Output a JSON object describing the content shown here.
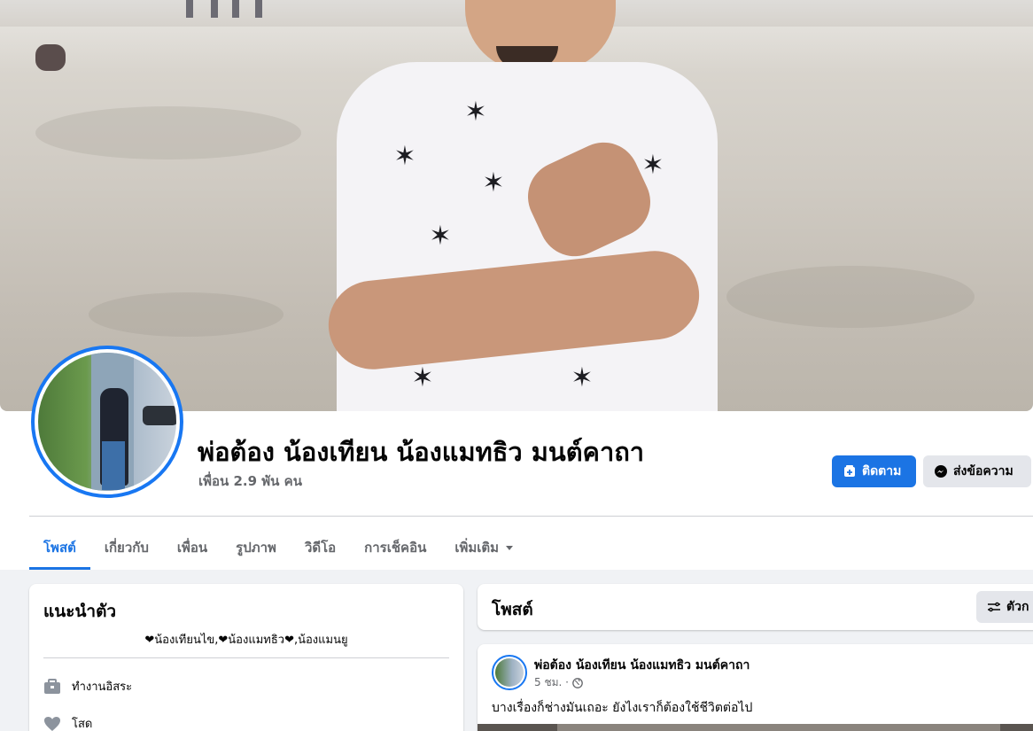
{
  "profile": {
    "name": "พ่อต้อง น้องเทียน น้องแมทธิว มนต์คาถา",
    "friends": "เพื่อน 2.9 พัน คน"
  },
  "actions": {
    "follow_label": "ติดตาม",
    "message_label": "ส่งข้อความ"
  },
  "tabs": [
    {
      "label": "โพสต์",
      "active": true
    },
    {
      "label": "เกี่ยวกับ"
    },
    {
      "label": "เพื่อน"
    },
    {
      "label": "รูปภาพ"
    },
    {
      "label": "วิดีโอ"
    },
    {
      "label": "การเช็คอิน"
    },
    {
      "label": "เพิ่มเติม"
    }
  ],
  "intro": {
    "title": "แนะนำตัว",
    "bio": "❤น้องเทียนไข,❤น้องแมทธิว❤,น้องแมนยู",
    "items": [
      {
        "icon": "briefcase-icon",
        "label": "ทำงานอิสระ"
      },
      {
        "icon": "heart-icon",
        "label": "โสด"
      }
    ]
  },
  "posts_section": {
    "title": "โพสต์",
    "filter_label": "ตัวก"
  },
  "post": {
    "author": "พ่อต้อง น้องเทียน น้องแมทธิว มนต์คาถา",
    "time": "5 ชม. ·",
    "text": "บางเรื่องก็ช่างมันเถอะ ยังไงเราก็ต้องใช้ชีวิตต่อไป"
  },
  "colors": {
    "accent": "#1b74e4",
    "secondary_text": "#65676b",
    "page_bg": "#f0f2f5"
  }
}
